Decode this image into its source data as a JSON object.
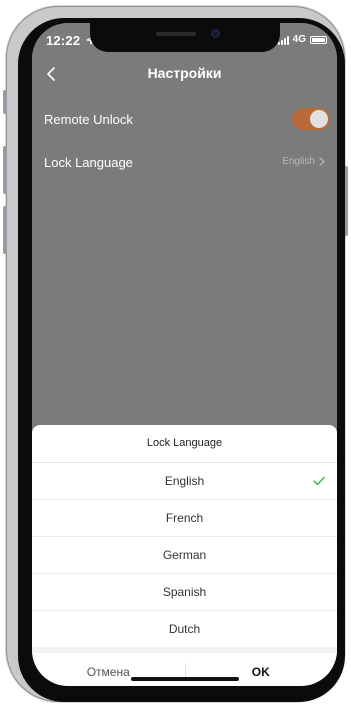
{
  "status_bar": {
    "time": "12:22",
    "network": "4G",
    "icons": [
      "location-arrow-icon",
      "signal-icon",
      "battery-icon"
    ]
  },
  "nav": {
    "title": "Настройки",
    "back_icon": "chevron-left-icon"
  },
  "settings": {
    "remote_unlock": {
      "label": "Remote Unlock",
      "enabled": true
    },
    "lock_language": {
      "label": "Lock Language",
      "value": "English"
    }
  },
  "sheet": {
    "title": "Lock Language",
    "options": [
      {
        "label": "English",
        "selected": true
      },
      {
        "label": "French",
        "selected": false
      },
      {
        "label": "German",
        "selected": false
      },
      {
        "label": "Spanish",
        "selected": false
      },
      {
        "label": "Dutch",
        "selected": false
      }
    ],
    "cancel_label": "Отмена",
    "ok_label": "OK"
  },
  "colors": {
    "accent": "#b86b39",
    "check": "#39b54a",
    "overlay": "#7b7b7b"
  }
}
